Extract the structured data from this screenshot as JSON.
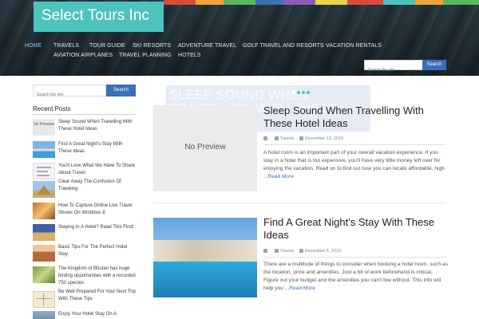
{
  "site": {
    "title": "Select Tours Inc"
  },
  "nav": {
    "items": [
      {
        "label": "HOME"
      },
      {
        "label": "TRAVELS"
      },
      {
        "label": "TOUR GUIDE"
      },
      {
        "label": "SKI RESORTS"
      },
      {
        "label": "ADVENTURE TRAVEL"
      },
      {
        "label": "GOLF TRAVEL AND RESORTS"
      },
      {
        "label": "VACATION RENTALS"
      },
      {
        "label": "AVIATION AIRPLANES"
      },
      {
        "label": "TRAVEL PLANNING"
      },
      {
        "label": "HOTELS"
      }
    ]
  },
  "header_search": {
    "placeholder": "Search the site",
    "button": "Search"
  },
  "sidebar": {
    "search": {
      "placeholder": "Search the site",
      "button": "Search"
    },
    "recent_title": "Recent Posts",
    "no_preview_thumb": "No Preview",
    "recent_posts": [
      {
        "title": "Sleep Sound When Travelling With These Hotel Ideas",
        "thumb": "no-preview"
      },
      {
        "title": "Find A Great Night's Stay With These Ideas",
        "thumb": "hotel-pool"
      },
      {
        "title": "You'll Love What We Have To Share About Travel",
        "thumb": "document"
      },
      {
        "title": "Clear Away The Confusion Of Traveling",
        "thumb": "pyramid"
      },
      {
        "title": "How To Capture Online Live Travel Shows On Windows 8",
        "thumb": "crowd"
      },
      {
        "title": "Staying In A Hotel? Read This First!",
        "thumb": "hotel-night"
      },
      {
        "title": "Basic Tips For The Perfect Hotel Stay",
        "thumb": "resort"
      },
      {
        "title": "The Kingdom of Bhutan has huge birding opportunities with a recorded 750 species",
        "thumb": "bird"
      },
      {
        "title": "Be Well Prepared For Your Next Trip With These Tips",
        "thumb": "map"
      },
      {
        "title": "Enjoy Your Hotel Stay On A",
        "thumb": "city"
      }
    ]
  },
  "slider": {
    "caption": "SLEEP SOUND WHEN TRAVELLING WITH THESE"
  },
  "posts": [
    {
      "title": "Sleep Sound When Travelling With These Hotel Ideas",
      "preview_label": "No Preview",
      "category": "Travels",
      "date": "December 13, 2015",
      "excerpt": "A hotel room is an important part of your overall vacation experience. If you stay in a hotel that is too expensive, you'll have very little money left over for enjoying the vacation. Read on to find out how you can locate affordable, high",
      "read_more": "...Read More"
    },
    {
      "title": "Find A Great Night's Stay With These Ideas",
      "category": "Travels",
      "date": "December 5, 2015",
      "excerpt": "There are a multitude of things to consider when booking a hotel room, such as the location, price and amenities. Just a bit of work beforehand is critical. Figure out your budget and the amenities you can't live without. This info will help you",
      "read_more": "...Read More"
    }
  ],
  "colors": {
    "accent": "#4ec3bd",
    "button": "#3b6fb6",
    "link": "#3b6fb6",
    "nav_active": "#8fd0ff"
  }
}
